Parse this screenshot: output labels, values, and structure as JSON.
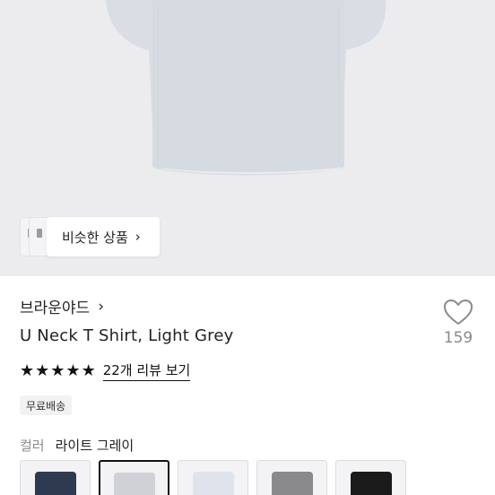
{
  "similar": {
    "label": "비슷한 상품"
  },
  "brand": {
    "name": "브라운야드"
  },
  "product": {
    "title": "U Neck T Shirt, Light Grey"
  },
  "like": {
    "count": "159"
  },
  "rating": {
    "stars": 5,
    "review_link": "22개 리뷰 보기"
  },
  "badge": {
    "label": "무료배송"
  },
  "color": {
    "label": "컬러",
    "value": "라이트 그레이",
    "swatches": [
      {
        "color": "#2e3a4f",
        "selected": false
      },
      {
        "color": "#cfd1d6",
        "selected": true
      },
      {
        "color": "#dfe4ec",
        "selected": false
      },
      {
        "color": "#8a8a8c",
        "selected": false
      },
      {
        "color": "#1b1b1b",
        "selected": false
      }
    ]
  },
  "colors": {
    "hero_bg": "#ececee",
    "shirt": "#d9dde4",
    "accent": "#111111"
  }
}
